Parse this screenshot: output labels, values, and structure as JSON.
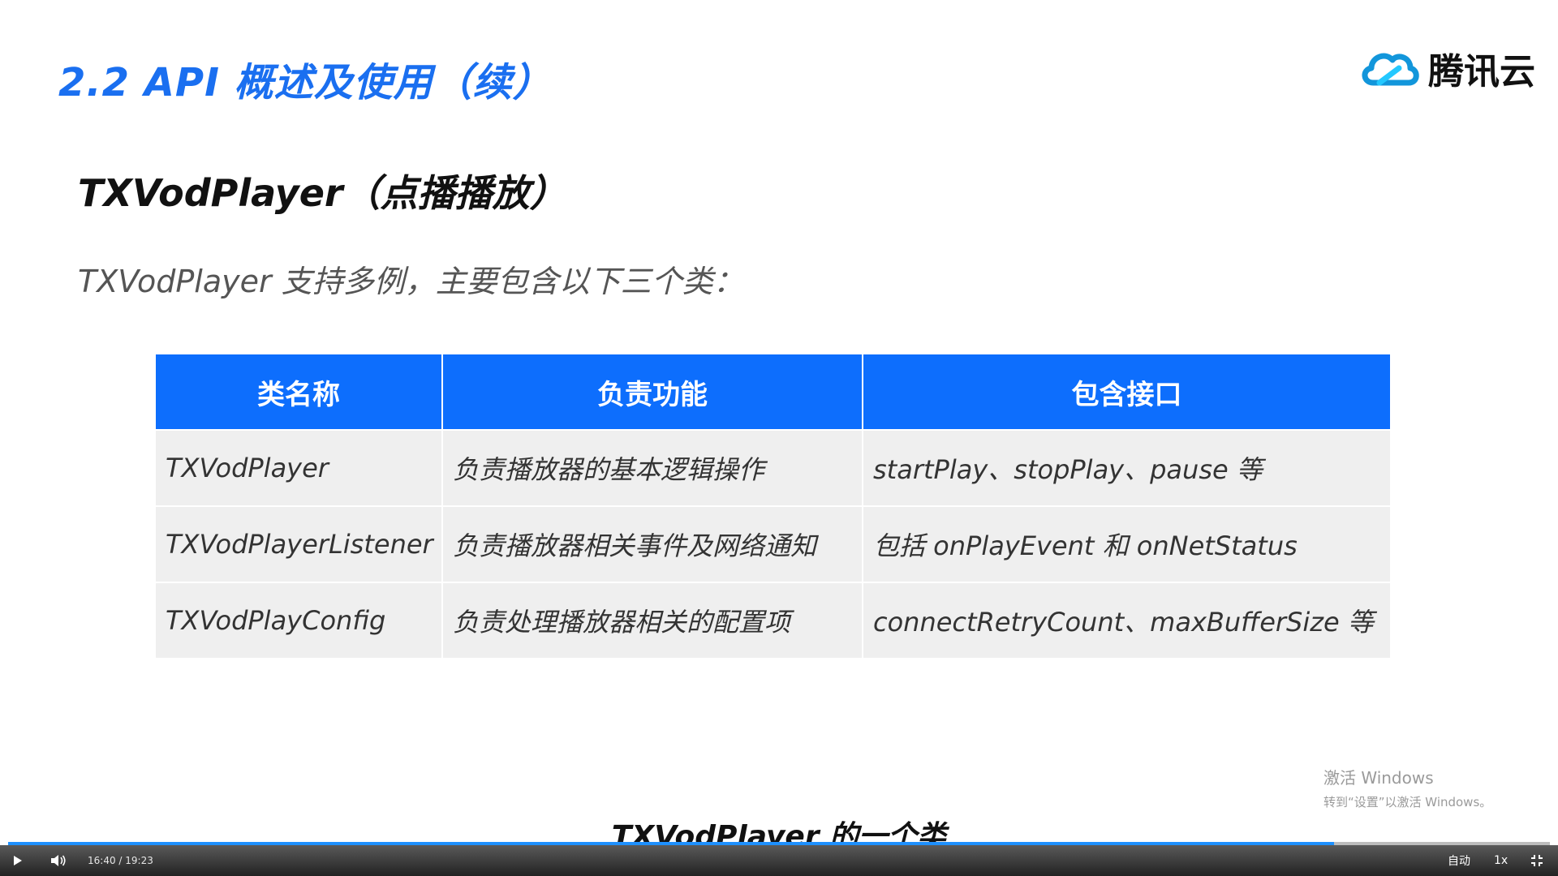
{
  "slide": {
    "title": "2.2 API 概述及使用（续）",
    "logo_text": "腾讯云",
    "section_title": "TXVodPlayer（点播播放）",
    "subtitle": "TXVodPlayer 支持多例，主要包含以下三个类："
  },
  "table": {
    "headers": [
      "类名称",
      "负责功能",
      "包含接口"
    ],
    "rows": [
      [
        "TXVodPlayer",
        "负责播放器的基本逻辑操作",
        "startPlay、stopPlay、pause 等"
      ],
      [
        "TXVodPlayerListener",
        "负责播放器相关事件及网络通知",
        "包括 onPlayEvent 和 onNetStatus"
      ],
      [
        "TXVodPlayConfig",
        "负责处理播放器相关的配置项",
        "connectRetryCount、maxBufferSize 等"
      ]
    ]
  },
  "caption": "TXVodPlayer 的一个类",
  "watermark": {
    "title": "激活 Windows",
    "subtitle": "转到“设置”以激活 Windows。"
  },
  "player": {
    "time": "16:40 / 19:23",
    "progress": 0.86,
    "quality": "自动",
    "speed": "1x"
  },
  "colors": {
    "accent": "#1a6ff0",
    "header_bg": "#0d6efd",
    "cell_bg": "#efefef",
    "progress": "#1e90ff"
  },
  "icons": [
    "cloud-logo-icon",
    "play-icon",
    "volume-icon",
    "fullscreen-exit-icon"
  ]
}
